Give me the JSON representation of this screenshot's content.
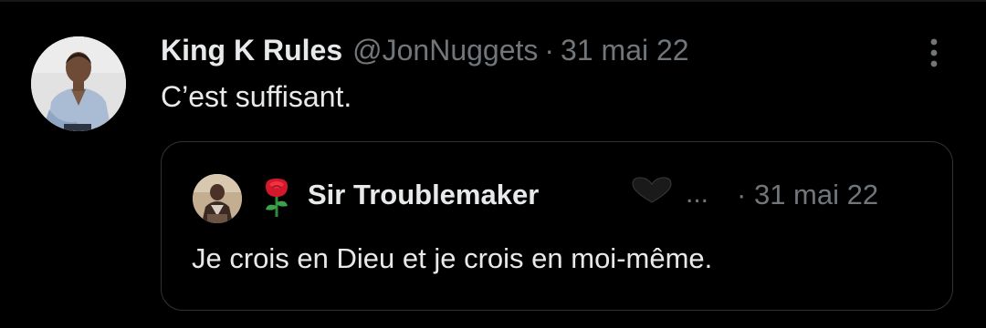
{
  "tweet": {
    "author": {
      "display_name": "King K Rules",
      "handle": "@JonNuggets",
      "avatar": "profile-photo"
    },
    "separator": "·",
    "date": "31 mai 22",
    "text": "C’est suffisant.",
    "more_icon": "more-vertical-icon"
  },
  "quoted_tweet": {
    "author": {
      "display_name": "Sir Troublemaker",
      "avatar": "profile-photo",
      "name_emojis": [
        "rose-emoji",
        "black-heart-emoji"
      ]
    },
    "truncation": "...",
    "separator": "·",
    "date": "31 mai 22",
    "text": "Je crois en Dieu et je crois en moi-même."
  },
  "colors": {
    "background": "#000000",
    "primary_text": "#e7e9ea",
    "secondary_text": "#71767b",
    "border": "#2f3336"
  }
}
